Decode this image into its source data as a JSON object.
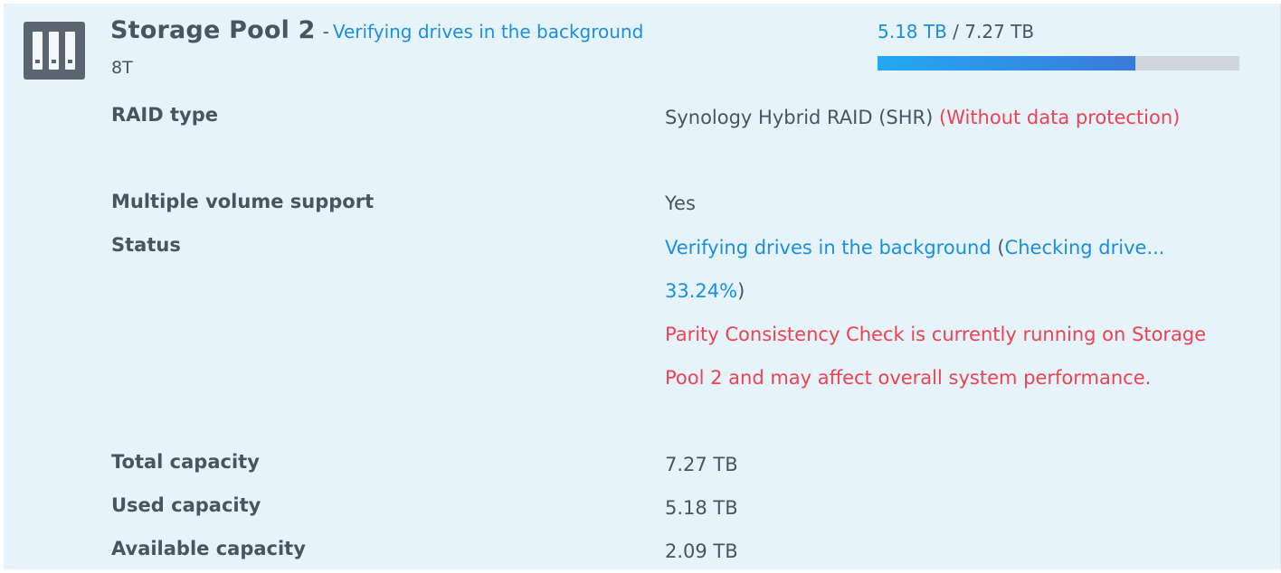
{
  "pool": {
    "title": "Storage Pool 2",
    "separator": "-",
    "status_short": "Verifying drives in the background",
    "subtitle": "8T",
    "icon": "storage-pool-icon"
  },
  "usage": {
    "used": "5.18 TB",
    "sep": " / ",
    "total": "7.27 TB",
    "fraction": 0.7125
  },
  "properties": {
    "raid_type": {
      "label": "RAID type",
      "value": "Synology Hybrid RAID (SHR)",
      "warning": "(Without data protection)"
    },
    "multiple_volume": {
      "label": "Multiple volume support",
      "value": "Yes"
    },
    "status": {
      "label": "Status",
      "status_text": "Verifying drives in the background",
      "paren_open": "(",
      "progress_text": "Checking drive... 33.24%",
      "paren_close": ")",
      "warning": "Parity Consistency Check is currently running on Storage Pool 2 and may affect overall system performance."
    },
    "total_capacity": {
      "label": "Total capacity",
      "value": "7.27 TB"
    },
    "used_capacity": {
      "label": "Used capacity",
      "value": "5.18 TB"
    },
    "available_capacity": {
      "label": "Available capacity",
      "value": "2.09 TB"
    }
  },
  "colors": {
    "accent_blue": "#1a8fe0",
    "warning_red": "#ef4250",
    "panel_bg": "#e6f3fb",
    "text": "#4a5461"
  }
}
